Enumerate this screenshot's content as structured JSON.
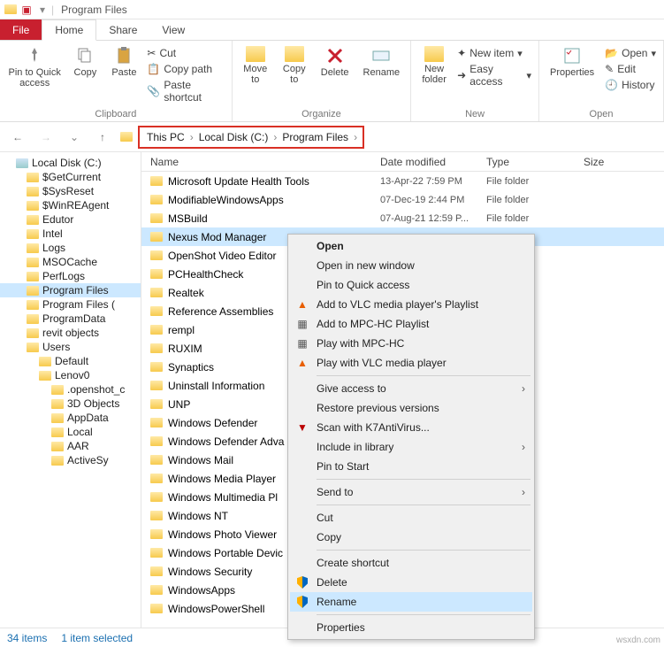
{
  "window": {
    "title": "Program Files"
  },
  "tabs": {
    "file": "File",
    "home": "Home",
    "share": "Share",
    "view": "View"
  },
  "ribbon": {
    "clipboard": {
      "pin": "Pin to Quick\naccess",
      "copy": "Copy",
      "paste": "Paste",
      "cut": "Cut",
      "copypath": "Copy path",
      "pasteshort": "Paste shortcut",
      "cap": "Clipboard"
    },
    "organize": {
      "moveto": "Move\nto",
      "copyto": "Copy\nto",
      "delete": "Delete",
      "rename": "Rename",
      "cap": "Organize"
    },
    "new": {
      "newfolder": "New\nfolder",
      "newitem": "New item",
      "easyaccess": "Easy access",
      "cap": "New"
    },
    "open": {
      "properties": "Properties",
      "open": "Open",
      "edit": "Edit",
      "history": "History",
      "cap": "Open"
    }
  },
  "breadcrumb": [
    "This PC",
    "Local Disk (C:)",
    "Program Files"
  ],
  "columns": {
    "name": "Name",
    "date": "Date modified",
    "type": "Type",
    "size": "Size"
  },
  "tree": [
    {
      "label": "Local Disk (C:)",
      "depth": 0,
      "icon": "drive"
    },
    {
      "label": "$GetCurrent",
      "depth": 1
    },
    {
      "label": "$SysReset",
      "depth": 1
    },
    {
      "label": "$WinREAgent",
      "depth": 1
    },
    {
      "label": "Edutor",
      "depth": 1
    },
    {
      "label": "Intel",
      "depth": 1
    },
    {
      "label": "Logs",
      "depth": 1
    },
    {
      "label": "MSOCache",
      "depth": 1
    },
    {
      "label": "PerfLogs",
      "depth": 1
    },
    {
      "label": "Program Files",
      "depth": 1,
      "sel": true
    },
    {
      "label": "Program Files (",
      "depth": 1
    },
    {
      "label": "ProgramData",
      "depth": 1
    },
    {
      "label": "revit objects",
      "depth": 1
    },
    {
      "label": "Users",
      "depth": 1
    },
    {
      "label": "Default",
      "depth": 2
    },
    {
      "label": "Lenov0",
      "depth": 2
    },
    {
      "label": ".openshot_c",
      "depth": 3
    },
    {
      "label": "3D Objects",
      "depth": 3,
      "icon": "3d"
    },
    {
      "label": "AppData",
      "depth": 3
    },
    {
      "label": "Local",
      "depth": 3
    },
    {
      "label": "AAR",
      "depth": 3
    },
    {
      "label": "ActiveSy",
      "depth": 3
    }
  ],
  "files": [
    {
      "name": "Microsoft Update Health Tools",
      "date": "13-Apr-22 7:59 PM",
      "type": "File folder"
    },
    {
      "name": "ModifiableWindowsApps",
      "date": "07-Dec-19 2:44 PM",
      "type": "File folder"
    },
    {
      "name": "MSBuild",
      "date": "07-Aug-21 12:59 P...",
      "type": "File folder"
    },
    {
      "name": "Nexus Mod Manager",
      "sel": true
    },
    {
      "name": "OpenShot Video Editor"
    },
    {
      "name": "PCHealthCheck"
    },
    {
      "name": "Realtek"
    },
    {
      "name": "Reference Assemblies"
    },
    {
      "name": "rempl"
    },
    {
      "name": "RUXIM"
    },
    {
      "name": "Synaptics"
    },
    {
      "name": "Uninstall Information"
    },
    {
      "name": "UNP"
    },
    {
      "name": "Windows Defender"
    },
    {
      "name": "Windows Defender Adva"
    },
    {
      "name": "Windows Mail"
    },
    {
      "name": "Windows Media Player"
    },
    {
      "name": "Windows Multimedia Pl"
    },
    {
      "name": "Windows NT"
    },
    {
      "name": "Windows Photo Viewer"
    },
    {
      "name": "Windows Portable Devic"
    },
    {
      "name": "Windows Security"
    },
    {
      "name": "WindowsApps"
    },
    {
      "name": "WindowsPowerShell"
    }
  ],
  "context": [
    {
      "label": "Open",
      "bold": true
    },
    {
      "label": "Open in new window"
    },
    {
      "label": "Pin to Quick access"
    },
    {
      "label": "Add to VLC media player's Playlist",
      "icon": "vlc"
    },
    {
      "label": "Add to MPC-HC Playlist",
      "icon": "mpc"
    },
    {
      "label": "Play with MPC-HC",
      "icon": "mpc"
    },
    {
      "label": "Play with VLC media player",
      "icon": "vlc"
    },
    {
      "sep": true
    },
    {
      "label": "Give access to",
      "sub": true
    },
    {
      "label": "Restore previous versions"
    },
    {
      "label": "Scan with K7AntiVirus...",
      "icon": "k7"
    },
    {
      "label": "Include in library",
      "sub": true
    },
    {
      "label": "Pin to Start"
    },
    {
      "sep": true
    },
    {
      "label": "Send to",
      "sub": true
    },
    {
      "sep": true
    },
    {
      "label": "Cut"
    },
    {
      "label": "Copy"
    },
    {
      "sep": true
    },
    {
      "label": "Create shortcut"
    },
    {
      "label": "Delete",
      "icon": "shield"
    },
    {
      "label": "Rename",
      "icon": "shield",
      "hov": true
    },
    {
      "sep": true
    },
    {
      "label": "Properties"
    }
  ],
  "status": {
    "count": "34 items",
    "sel": "1 item selected"
  },
  "watermark": "wsxdn.com"
}
